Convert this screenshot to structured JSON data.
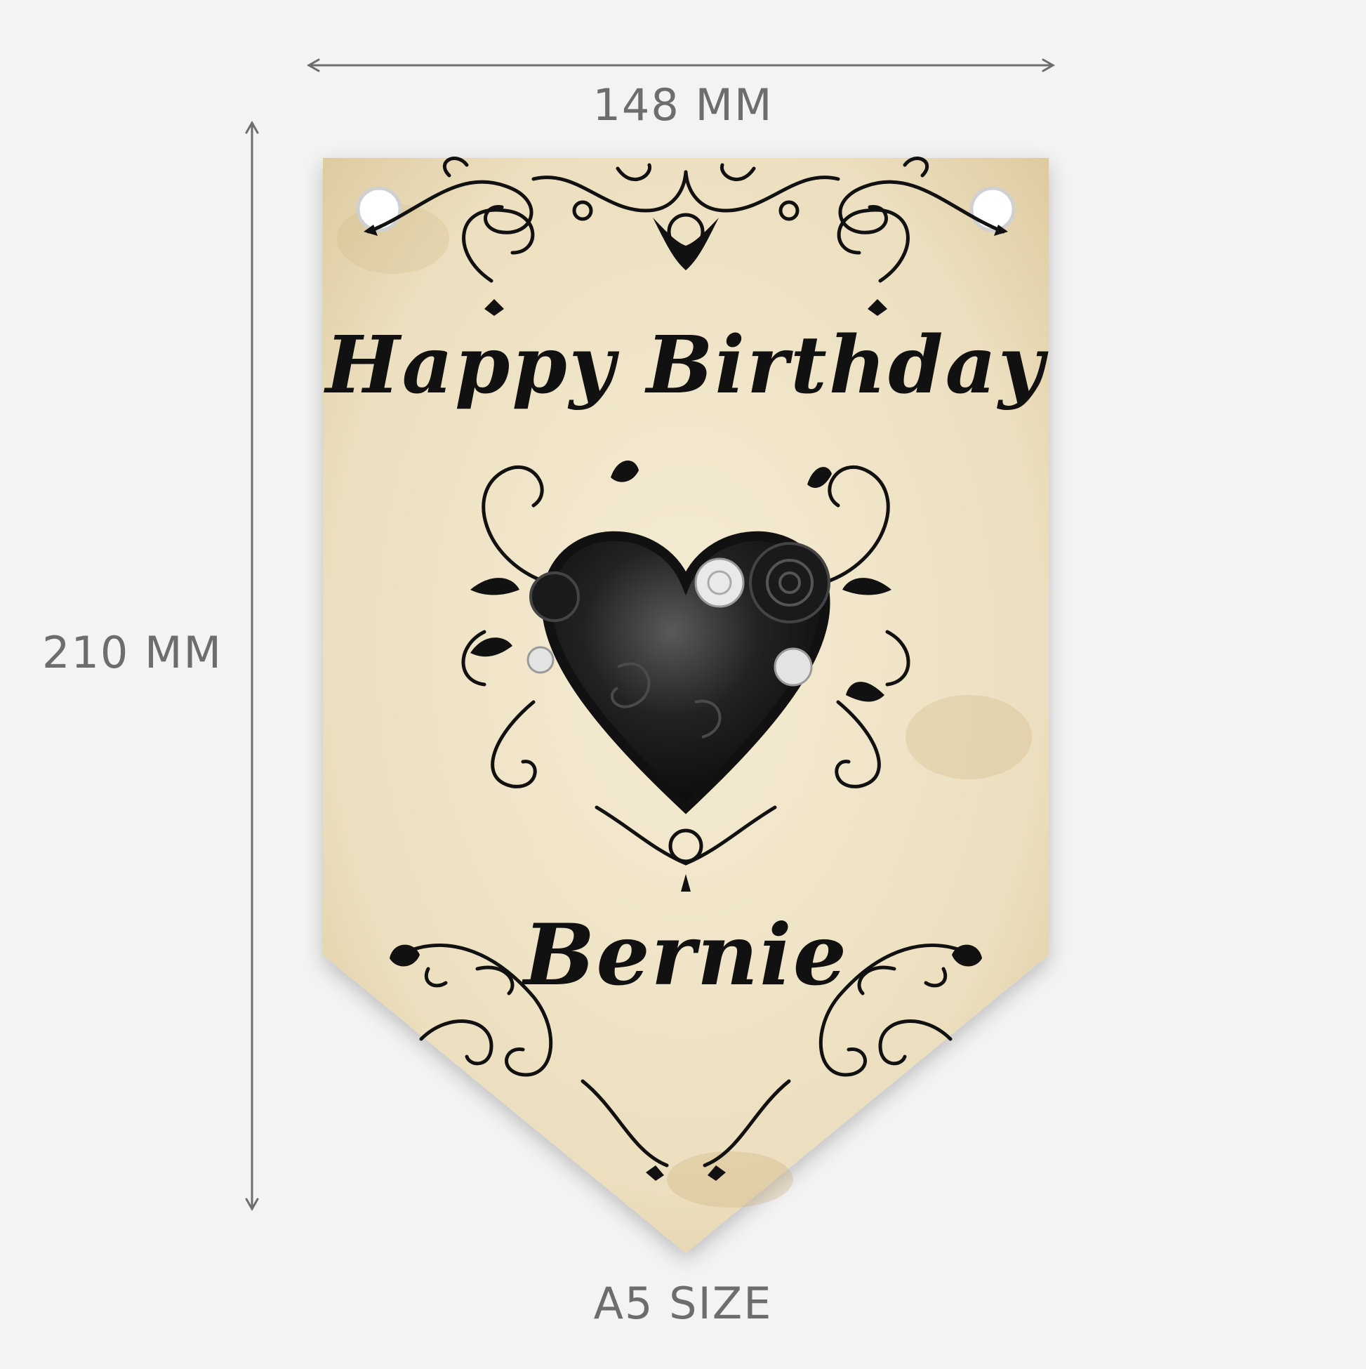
{
  "dimensions": {
    "width_label": "148 MM",
    "height_label": "210 MM",
    "size_label": "A5 SIZE"
  },
  "banner": {
    "greeting": "Happy Birthday",
    "name": "Bernie",
    "paper_color": "#efe3c6",
    "ink_color": "#111111"
  },
  "colors": {
    "background": "#f3f3f3",
    "dimension_lines": "#6d6d6d"
  }
}
